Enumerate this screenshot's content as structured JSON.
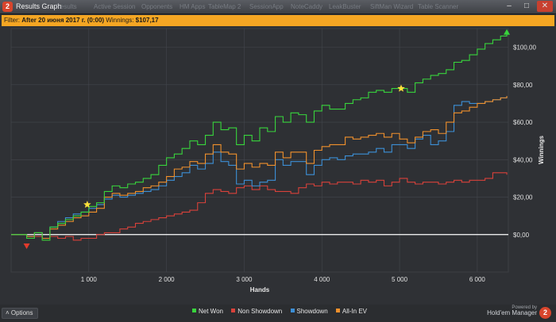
{
  "window": {
    "title": "Results Graph",
    "app_icon": "holdem-manager-icon",
    "background_tabs": [
      "Results",
      "Active Session",
      "Opponents",
      "HM Apps",
      "TableMap 2",
      "SessionApp",
      "NoteCaddy",
      "LeakBuster",
      "SiftMan Wizard",
      "Table Scanner"
    ],
    "buttons": {
      "minimize": "minimize-icon",
      "maximize": "maximize-icon",
      "close": "close-icon"
    }
  },
  "filter": {
    "prefix": "Filter:",
    "value": "After 20 июня 2017 г. (0:00)",
    "winnings_label": "Winnings:",
    "winnings_value": "$107,17"
  },
  "bottom": {
    "options_label": "Options",
    "brand_powered": "Powered by",
    "brand_name": "Hold'em Manager",
    "brand_logo": "2"
  },
  "colors": {
    "net_won": "#38d43c",
    "non_showdown": "#d8413a",
    "showdown": "#3c8fd6",
    "all_in_ev": "#f0902c",
    "zero_line": "#ffffff",
    "filter_bar": "#f5a623"
  },
  "chart_data": {
    "type": "line",
    "xlabel": "Hands",
    "ylabel": "Winnings",
    "xlim": [
      0,
      6400
    ],
    "ylim": [
      -20,
      110
    ],
    "x_ticks": [
      1000,
      2000,
      3000,
      4000,
      5000,
      6000
    ],
    "x_tick_labels": [
      "1 000",
      "2 000",
      "3 000",
      "4 000",
      "5 000",
      "6 000"
    ],
    "y_ticks": [
      0,
      20,
      40,
      60,
      80,
      100
    ],
    "y_tick_labels": [
      "$0,00",
      "$20,00",
      "$40,00",
      "$60,00",
      "$80,00",
      "$100,00"
    ],
    "grid": true,
    "legend_position": "bottom",
    "series": [
      {
        "name": "Net Won",
        "color": "#38d43c",
        "x": [
          0,
          100,
          200,
          300,
          400,
          500,
          600,
          700,
          800,
          900,
          1000,
          1100,
          1200,
          1300,
          1400,
          1500,
          1600,
          1700,
          1800,
          1900,
          2000,
          2100,
          2200,
          2300,
          2400,
          2500,
          2600,
          2700,
          2800,
          2900,
          3000,
          3100,
          3200,
          3300,
          3400,
          3500,
          3600,
          3700,
          3800,
          3900,
          4000,
          4100,
          4200,
          4300,
          4400,
          4500,
          4600,
          4700,
          4800,
          4900,
          5000,
          5100,
          5200,
          5300,
          5400,
          5500,
          5600,
          5700,
          5800,
          5900,
          6000,
          6100,
          6200,
          6300,
          6380
        ],
        "y": [
          0,
          0,
          -2,
          1,
          -3,
          4,
          6,
          8,
          10,
          12,
          15,
          17,
          23,
          26,
          25,
          27,
          28,
          30,
          32,
          37,
          41,
          43,
          46,
          50,
          48,
          53,
          60,
          56,
          57,
          48,
          53,
          50,
          57,
          55,
          63,
          60,
          65,
          64,
          60,
          66,
          69,
          67,
          67,
          70,
          72,
          73,
          76,
          77,
          76,
          78,
          78,
          76,
          81,
          83,
          85,
          86,
          88,
          92,
          93,
          96,
          99,
          102,
          104,
          106,
          108
        ]
      },
      {
        "name": "Non Showdown",
        "color": "#d8413a",
        "x": [
          0,
          100,
          200,
          300,
          400,
          500,
          600,
          700,
          800,
          900,
          1000,
          1100,
          1200,
          1300,
          1400,
          1500,
          1600,
          1700,
          1800,
          1900,
          2000,
          2100,
          2200,
          2300,
          2400,
          2500,
          2600,
          2700,
          2800,
          2900,
          3000,
          3100,
          3200,
          3300,
          3400,
          3500,
          3600,
          3700,
          3800,
          3900,
          4000,
          4100,
          4200,
          4300,
          4400,
          4500,
          4600,
          4700,
          4800,
          4900,
          5000,
          5100,
          5200,
          5300,
          5400,
          5500,
          5600,
          5700,
          5800,
          5900,
          6000,
          6100,
          6200,
          6300,
          6380
        ],
        "y": [
          0,
          0,
          -1,
          -1,
          -2,
          -1,
          -2,
          -1,
          -3,
          -2,
          -2,
          0,
          1,
          1,
          3,
          4,
          6,
          7,
          8,
          9,
          10,
          11,
          12,
          13,
          17,
          22,
          24,
          23,
          22,
          25,
          26,
          24,
          26,
          24,
          23,
          23,
          22,
          25,
          27,
          26,
          28,
          27,
          28,
          28,
          27,
          29,
          28,
          29,
          26,
          28,
          30,
          28,
          27,
          28,
          28,
          27,
          28,
          29,
          28,
          29,
          29,
          30,
          33,
          33,
          32
        ]
      },
      {
        "name": "Showdown",
        "color": "#3c8fd6",
        "x": [
          0,
          100,
          200,
          300,
          400,
          500,
          600,
          700,
          800,
          900,
          1000,
          1100,
          1200,
          1300,
          1400,
          1500,
          1600,
          1700,
          1800,
          1900,
          2000,
          2100,
          2200,
          2300,
          2400,
          2500,
          2600,
          2700,
          2800,
          2900,
          3000,
          3100,
          3200,
          3300,
          3400,
          3500,
          3600,
          3700,
          3800,
          3900,
          4000,
          4100,
          4200,
          4300,
          4400,
          4500,
          4600,
          4700,
          4800,
          4900,
          5000,
          5100,
          5200,
          5300,
          5400,
          5500,
          5600,
          5700,
          5800,
          5900,
          6000,
          6100,
          6200,
          6300,
          6380
        ],
        "y": [
          0,
          0,
          -1,
          1,
          -2,
          4,
          7,
          9,
          11,
          12,
          14,
          16,
          19,
          21,
          20,
          21,
          22,
          23,
          24,
          26,
          29,
          31,
          33,
          37,
          35,
          38,
          44,
          39,
          37,
          27,
          29,
          26,
          28,
          29,
          40,
          37,
          39,
          39,
          32,
          37,
          40,
          41,
          40,
          42,
          43,
          43,
          44,
          46,
          44,
          48,
          48,
          46,
          51,
          53,
          48,
          50,
          55,
          69,
          71,
          70,
          70,
          71,
          72,
          73,
          74
        ]
      },
      {
        "name": "All-In EV",
        "color": "#f0902c",
        "x": [
          0,
          100,
          200,
          300,
          400,
          500,
          600,
          700,
          800,
          900,
          1000,
          1100,
          1200,
          1300,
          1400,
          1500,
          1600,
          1700,
          1800,
          1900,
          2000,
          2100,
          2200,
          2300,
          2400,
          2500,
          2600,
          2700,
          2800,
          2900,
          3000,
          3100,
          3200,
          3300,
          3400,
          3500,
          3600,
          3700,
          3800,
          3900,
          4000,
          4100,
          4200,
          4300,
          4400,
          4500,
          4600,
          4700,
          4800,
          4900,
          5000,
          5100,
          5200,
          5300,
          5400,
          5500,
          5600,
          5700,
          5800,
          5900,
          6000,
          6100,
          6200,
          6300,
          6380
        ],
        "y": [
          0,
          0,
          -1,
          1,
          -2,
          3,
          5,
          7,
          9,
          10,
          12,
          14,
          20,
          22,
          21,
          22,
          23,
          25,
          26,
          28,
          31,
          35,
          36,
          39,
          38,
          43,
          48,
          44,
          43,
          35,
          38,
          36,
          38,
          37,
          44,
          41,
          44,
          44,
          38,
          45,
          47,
          48,
          48,
          52,
          51,
          52,
          53,
          54,
          52,
          54,
          51,
          49,
          52,
          55,
          56,
          54,
          60,
          65,
          66,
          68,
          70,
          71,
          72,
          73,
          74
        ]
      }
    ],
    "annotations": [
      {
        "type": "star",
        "x": 980,
        "y": 16,
        "color": "#ffe23a"
      },
      {
        "type": "star",
        "x": 5020,
        "y": 78,
        "color": "#ffe23a"
      },
      {
        "type": "triangle-down",
        "x": 200,
        "y": -6,
        "color": "#e23a2c"
      },
      {
        "type": "triangle-up",
        "x": 6380,
        "y": 108,
        "color": "#38d43c"
      }
    ]
  }
}
